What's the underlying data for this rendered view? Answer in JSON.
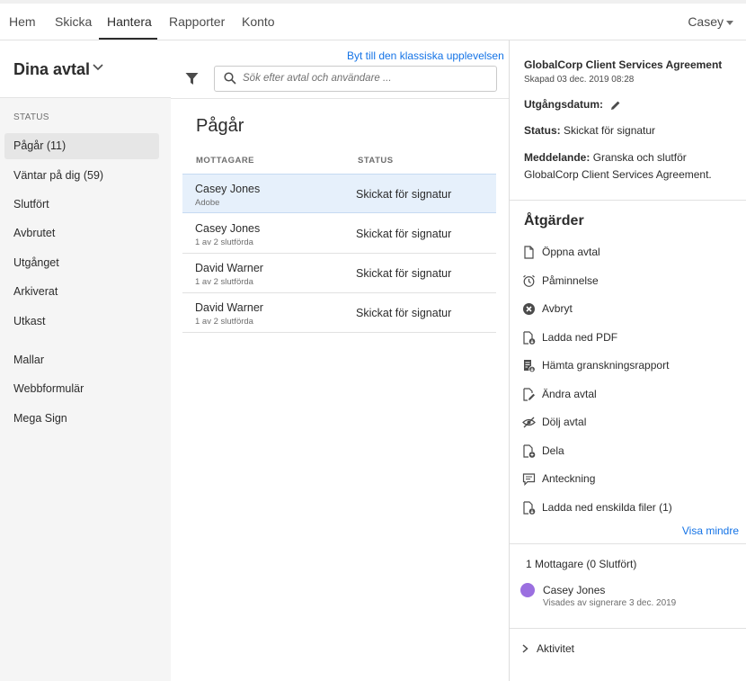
{
  "nav": {
    "tabs": [
      {
        "label": "Hem"
      },
      {
        "label": "Skicka"
      },
      {
        "label": "Hantera"
      },
      {
        "label": "Rapporter"
      },
      {
        "label": "Konto"
      }
    ],
    "active_tab": "Hantera",
    "user": "Casey"
  },
  "sidebar": {
    "title": "Dina avtal",
    "section_label": "STATUS",
    "status_items": [
      {
        "label": "Pågår (11)"
      },
      {
        "label": "Väntar på dig (59)"
      },
      {
        "label": "Slutfört"
      },
      {
        "label": "Avbrutet"
      },
      {
        "label": "Utgånget"
      },
      {
        "label": "Arkiverat"
      },
      {
        "label": "Utkast"
      }
    ],
    "other_items": [
      {
        "label": "Mallar"
      },
      {
        "label": "Webbformulär"
      },
      {
        "label": "Mega Sign"
      }
    ]
  },
  "list": {
    "switch_link": "Byt till den klassiska upplevelsen",
    "search_placeholder": "Sök efter avtal och användare ...",
    "title": "Pågår",
    "col_recipient": "MOTTAGARE",
    "col_status": "STATUS",
    "rows": [
      {
        "name": "Casey Jones",
        "sub": "Adobe",
        "status": "Skickat för signatur"
      },
      {
        "name": "Casey Jones",
        "sub": "1 av 2 slutförda",
        "status": "Skickat för signatur"
      },
      {
        "name": "David Warner",
        "sub": "1 av 2 slutförda",
        "status": "Skickat för signatur"
      },
      {
        "name": "David Warner",
        "sub": "1 av 2 slutförda",
        "status": "Skickat för signatur"
      }
    ]
  },
  "detail": {
    "agreement_title": "GlobalCorp Client Services Agreement",
    "created": "Skapad 03 dec. 2019 08:28",
    "expiry_label": "Utgångsdatum:",
    "status_label": "Status:",
    "status_value": "Skickat för signatur",
    "message_label": "Meddelande:",
    "message_value": "Granska och slutför GlobalCorp Client Services Agreement.",
    "actions_title": "Åtgärder",
    "actions": [
      {
        "label": "Öppna avtal",
        "icon": "document-icon"
      },
      {
        "label": "Påminnelse",
        "icon": "alarm-clock-icon"
      },
      {
        "label": "Avbryt",
        "icon": "cancel-circle-icon"
      },
      {
        "label": "Ladda ned PDF",
        "icon": "download-pdf-icon"
      },
      {
        "label": "Hämta granskningsrapport",
        "icon": "audit-report-icon"
      },
      {
        "label": "Ändra avtal",
        "icon": "edit-document-icon"
      },
      {
        "label": "Dölj avtal",
        "icon": "hide-eye-icon"
      },
      {
        "label": "Dela",
        "icon": "share-document-icon"
      },
      {
        "label": "Anteckning",
        "icon": "note-icon"
      },
      {
        "label": "Ladda ned enskilda filer (1)",
        "icon": "download-files-icon"
      }
    ],
    "show_less": "Visa mindre",
    "recipients_count": "1 Mottagare (0 Slutfört)",
    "recipient_name": "Casey Jones",
    "recipient_sub": "Visades av signerare 3 dec. 2019",
    "activity_label": "Aktivitet"
  },
  "colors": {
    "accent_blue": "#1473e6",
    "selected_row": "#e6f0fb",
    "avatar": "#9b6fe0"
  }
}
